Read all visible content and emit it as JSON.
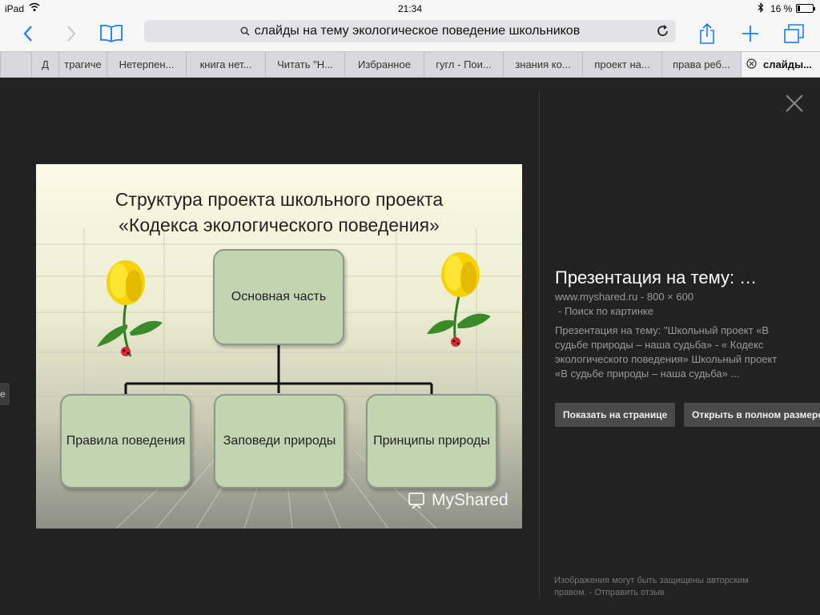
{
  "status": {
    "device": "iPad",
    "time": "21:34",
    "battery_text": "16 %",
    "battery_level": 0.16
  },
  "toolbar": {
    "url_text": "слайды на тему экологическое поведение школьников"
  },
  "tabs": [
    {
      "label": "Д"
    },
    {
      "label": "трагиче"
    },
    {
      "label": "Нетерпен..."
    },
    {
      "label": "книга нет..."
    },
    {
      "label": "Читать \"Н..."
    },
    {
      "label": "Избранное"
    },
    {
      "label": "гугл - Пои..."
    },
    {
      "label": "знания ко..."
    },
    {
      "label": "проект на..."
    },
    {
      "label": "права реб..."
    },
    {
      "label": "слайды..."
    }
  ],
  "viewer": {
    "side_label": "е"
  },
  "slide": {
    "title_line1": "Структура проекта школьного проекта",
    "title_line2": "«Кодекса экологического поведения»",
    "main_box": "Основная часть",
    "box1": "Правила поведения",
    "box2": "Заповеди природы",
    "box3": "Принципы природы",
    "watermark": "MyShared"
  },
  "info": {
    "title": "Презентация на тему: …",
    "source": "www.myshared.ru - 800 × 600",
    "sub_link": "- Поиск по картинке",
    "description": "Презентация на тему: \"Школьный проект «В судьбе природы – наша судьба» - « Кодекс экологического поведения» Школьный проект «В судьбе природы – наша судьба» ...",
    "btn_show": "Показать на странице",
    "btn_open": "Открыть в полном размере",
    "footer_text": "Изображения могут быть защищены авторским правом.",
    "feedback_link": "- Отправить отзыв"
  },
  "colors": {
    "accent": "#1a7cf6",
    "slide_box": "#c3d4b3"
  }
}
